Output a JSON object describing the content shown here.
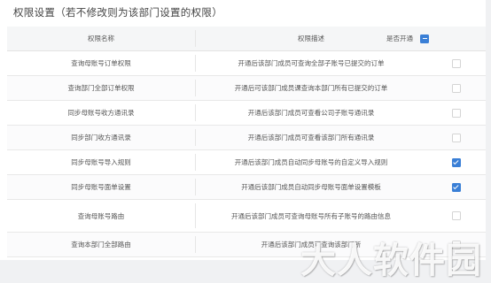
{
  "section": {
    "title": "权限设置（若不修改则为该部门设置的权限）"
  },
  "table": {
    "headers": {
      "name": "权限名称",
      "desc": "权限描述",
      "open": "是否开通"
    },
    "select_all_checked": true,
    "rows": [
      {
        "name": "查询母账号订单权限",
        "desc": "开通后该部门成员可查询全部子账号已提交的订单",
        "checked": false
      },
      {
        "name": "查询部门全部订单权限",
        "desc": "开通后可该部门成员课查询本部门所有已提交的订单",
        "checked": false
      },
      {
        "name": "同步母账号收方通讯录",
        "desc": "开通后该部门成员可查看公司子账号通讯录",
        "checked": false
      },
      {
        "name": "同步部门收方通讯录",
        "desc": "开通后该部门成员可查看该部门所有通讯录",
        "checked": false
      },
      {
        "name": "同步母账号导入规则",
        "desc": "开通后该部门成员自动同步母账号的自定义导入规则",
        "checked": true
      },
      {
        "name": "同步母账号面单设置",
        "desc": "开通后该部门成员自动同步母账号面单设置模板",
        "checked": true
      },
      {
        "name": "查询母账号路由",
        "desc": "开通后该部门成员可查询母账号所有子账号的路由信息",
        "checked": false
      },
      {
        "name": "查询本部门全部路由",
        "desc": "开通后该部门成员可查询该部门所",
        "checked": false
      }
    ]
  },
  "watermark": {
    "text": "大人软件园"
  }
}
